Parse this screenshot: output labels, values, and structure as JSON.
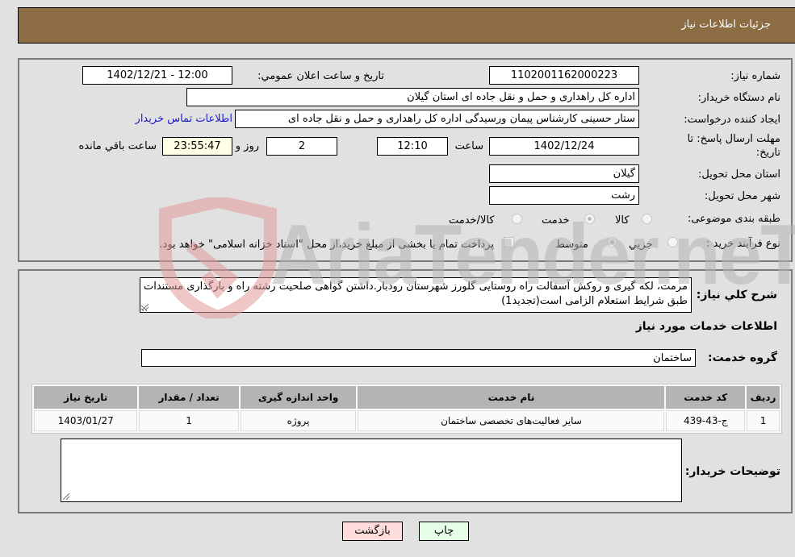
{
  "header": {
    "title": "جزئیات اطلاعات نیاز"
  },
  "form": {
    "need_number": {
      "label": "شماره نیاز:",
      "value": "1102001162000223"
    },
    "announce_datetime": {
      "label": "تاريخ و ساعت اعلان عمومي:",
      "value": "1402/12/21 - 12:00"
    },
    "buyer_org": {
      "label": "نام دستگاه خریدار:",
      "value": "اداره کل راهداری و حمل و نقل جاده ای استان گیلان"
    },
    "requester": {
      "label": "ایجاد کننده درخواست:",
      "value": "ستار حسینی کارشناس پیمان ورسیدگی اداره کل راهداری و حمل و نقل جاده ای",
      "contact_link": "اطلاعات تماس خریدار"
    },
    "deadline": {
      "label_line1": "مهلت ارسال پاسخ: تا",
      "label_line2": "تاریخ:",
      "date": "1402/12/24",
      "time_label": "ساعت",
      "time": "12:10",
      "days": "2",
      "days_label": "روز و",
      "remaining": "23:55:47",
      "remaining_label": "ساعت باقي مانده"
    },
    "province": {
      "label": "استان محل تحویل:",
      "value": "گیلان"
    },
    "city": {
      "label": "شهر محل تحویل:",
      "value": "رشت"
    },
    "category": {
      "label": "طبقه بندی موضوعی:",
      "options": [
        "کالا",
        "خدمت",
        "کالا/خدمت"
      ],
      "selected": "خدمت"
    },
    "purchase_type": {
      "label": "نوع فرآیند خرید :",
      "options": [
        "جزيي",
        "متوسط"
      ],
      "selected": "متوسط",
      "treasury_note": "پرداخت تمام یا بخشی از مبلغ خرید،از محل \"اسناد خزانه اسلامی\" خواهد بود."
    }
  },
  "description": {
    "label": "شرح کلي نياز:",
    "value": "مرمت، لکه گیری و روکش آسفالت راه روستایی گلورز شهرستان رودبار.داشتن گواهی صلحیت رشته راه و بارگذاری مستندات طبق شرایط استعلام الزامی است(تجدید1)"
  },
  "services_section": {
    "title": "اطلاعات خدمات مورد نياز"
  },
  "service_group": {
    "label": "گروه خدمت:",
    "value": "ساختمان"
  },
  "table": {
    "headers": [
      "رديف",
      "کد خدمت",
      "نام خدمت",
      "واحد اندازه گیری",
      "تعداد / مقدار",
      "تاریخ نیاز"
    ],
    "rows": [
      [
        "1",
        "ج-43-439",
        "سایر فعالیت‌های تخصصی ساختمان",
        "پروژه",
        "1",
        "1403/01/27"
      ]
    ]
  },
  "buyer_notes": {
    "label": "توضيحات خريدار:",
    "value": ""
  },
  "buttons": {
    "print": "چاپ",
    "back": "بازگشت"
  },
  "watermark": {
    "text": "AriaTender.neT"
  }
}
